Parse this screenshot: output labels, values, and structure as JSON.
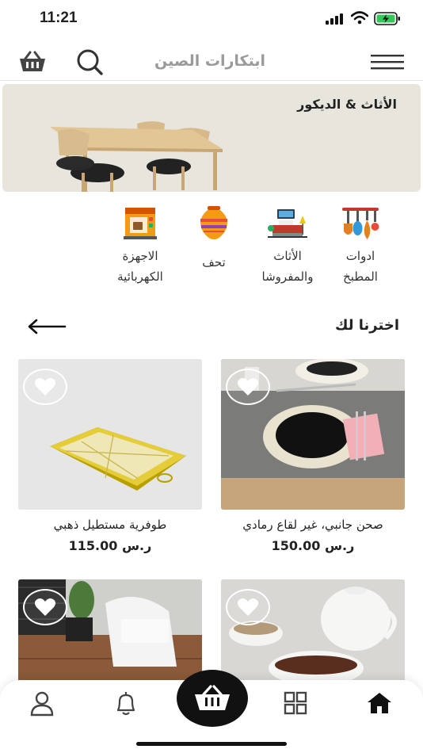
{
  "status": {
    "time": "11:21"
  },
  "header": {
    "title": "ابتكارات الصين",
    "icons": [
      "basket-icon",
      "search-icon",
      "menu-icon"
    ]
  },
  "banner": {
    "title": "الأثاث & الديكور"
  },
  "categories": [
    {
      "label": "ادوات\nالمطبخ",
      "icon": "kitchen-tools-icon"
    },
    {
      "label": "الأثاث\nوالمفروشا",
      "icon": "furniture-icon"
    },
    {
      "label": "تحف",
      "icon": "vase-icon"
    },
    {
      "label": "الاجهزة\nالكهربائية",
      "icon": "coffee-machine-icon"
    }
  ],
  "section": {
    "title": "اخترنا لك"
  },
  "products": [
    {
      "name": "صحن جانبي، غير لقاع رمادي",
      "price": "150.00 ر.س"
    },
    {
      "name": "طوفرية مستطيل ذهبي",
      "price": "115.00 ر.س"
    },
    {
      "name": "",
      "price": ""
    },
    {
      "name": "",
      "price": ""
    }
  ],
  "nav": {
    "items": [
      "home-icon",
      "grid-icon",
      "cart-icon",
      "bell-icon",
      "user-icon"
    ],
    "active": "home-icon"
  },
  "colors": {
    "accent": "#111111",
    "header_title": "#9a9a9a",
    "banner_bg": "#e8e5dd"
  }
}
